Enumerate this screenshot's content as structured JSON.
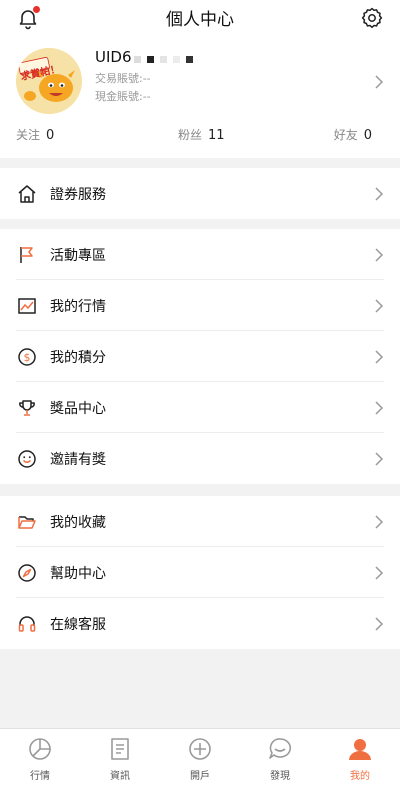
{
  "header": {
    "title": "個人中心",
    "bell_icon": "bell-icon",
    "settings_icon": "gear-icon"
  },
  "profile": {
    "uid": "UID6",
    "trade_account": "交易賬號:--",
    "cash_account": "現金賬號:--",
    "avatar_caption": "求賞帕！",
    "stats": [
      {
        "label": "关注",
        "value": "0"
      },
      {
        "label": "粉丝",
        "value": "11"
      },
      {
        "label": "好友",
        "value": "0"
      }
    ]
  },
  "menu": {
    "securities": {
      "label": "證券服務",
      "icon": "house-icon"
    },
    "items": [
      {
        "label": "活動專區",
        "icon": "flag-icon"
      },
      {
        "label": "我的行情",
        "icon": "trend-chart-icon"
      },
      {
        "label": "我的積分",
        "icon": "dollar-coin-icon"
      },
      {
        "label": "獎品中心",
        "icon": "trophy-icon"
      },
      {
        "label": "邀請有獎",
        "icon": "smiley-icon"
      }
    ],
    "extras": [
      {
        "label": "我的收藏",
        "icon": "folder-icon"
      },
      {
        "label": "幫助中心",
        "icon": "compass-icon"
      },
      {
        "label": "在線客服",
        "icon": "headset-icon"
      }
    ]
  },
  "tabbar": {
    "tabs": [
      {
        "label": "行情",
        "icon": "pie-chart-icon"
      },
      {
        "label": "資訊",
        "icon": "document-icon"
      },
      {
        "label": "開戶",
        "icon": "plus-circle-icon"
      },
      {
        "label": "發現",
        "icon": "chat-bubble-icon"
      },
      {
        "label": "我的",
        "icon": "person-icon",
        "active": true
      }
    ],
    "active_color": "#f06f40"
  },
  "colors": {
    "accent": "#f06f40",
    "notification_dot": "#e8302a",
    "background": "#f2f2f2"
  }
}
